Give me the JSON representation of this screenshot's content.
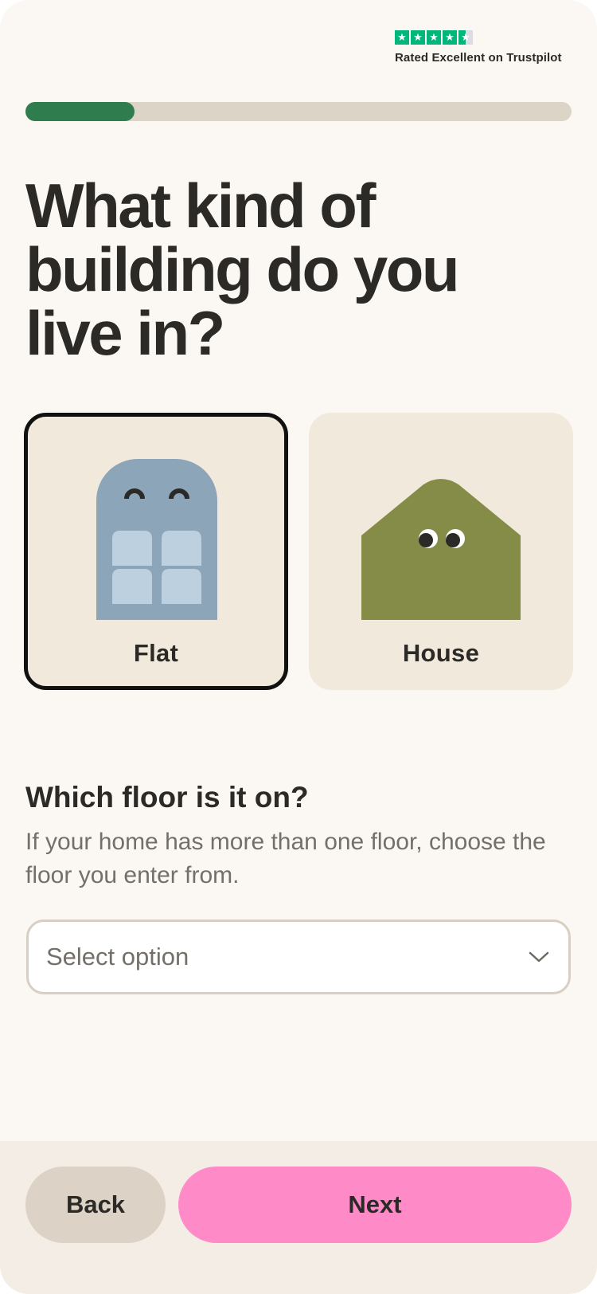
{
  "trustpilot": {
    "rating_text": "Rated Excellent on Trustpilot",
    "stars": 4.5,
    "star_color": "#00b67a"
  },
  "progress": {
    "fraction": 0.2,
    "fill_color": "#2f7d4f",
    "track_color": "#ddd4c8"
  },
  "question": {
    "title": "What kind of building do you live in?"
  },
  "options": [
    {
      "label": "Flat",
      "icon": "flat-building-icon",
      "selected": true
    },
    {
      "label": "House",
      "icon": "house-icon",
      "selected": false
    }
  ],
  "floor": {
    "heading": "Which floor is it on?",
    "help_text": "If your home has more than one floor, choose the floor you enter from.",
    "select_placeholder": "Select option",
    "select_icon": "chevron-down-icon"
  },
  "footer": {
    "back_label": "Back",
    "next_label": "Next"
  },
  "colors": {
    "background": "#fbf7f3",
    "card": "#f2e9dd",
    "next_button": "#ff8ac8",
    "back_button": "#dcd3c6",
    "flat_building": "#8da5b8",
    "house": "#848c48"
  }
}
